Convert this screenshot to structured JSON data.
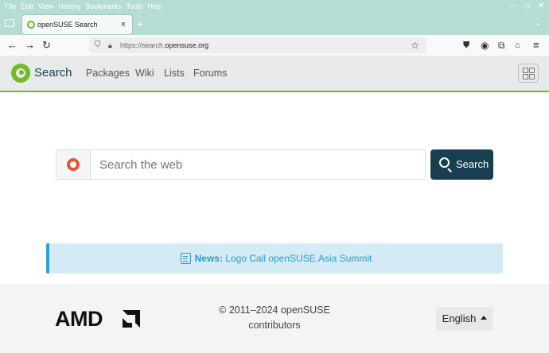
{
  "browser": {
    "menu": [
      "File",
      "Edit",
      "View",
      "History",
      "Bookmarks",
      "Tools",
      "Help"
    ],
    "tab_title": "openSUSE Search",
    "tab_close": "×",
    "new_tab": "+",
    "url_prefix": "https://search.",
    "url_domain": "opensuse.org",
    "icons": [
      "back-arrow-icon",
      "forward-arrow-icon",
      "reload-icon",
      "shield-icon",
      "lock-icon",
      "star-icon",
      "pocket-icon",
      "account-icon",
      "extensions-icon",
      "hat-icon",
      "hamburger-menu-icon"
    ]
  },
  "site": {
    "brand": "Search",
    "nav": [
      "Packages",
      "Wiki",
      "Lists",
      "Forums"
    ],
    "search_placeholder": "Search the web",
    "search_button": "Search",
    "news_label": "News:",
    "news_link": "Logo Call openSUSE.Asia Summit",
    "footer_sponsor": "AMD",
    "copyright_line1": "© 2011–2024 openSUSE",
    "copyright_line2": "contributors",
    "language": "English"
  },
  "colors": {
    "accent_green": "#73ba25",
    "dark_teal": "#173f4f",
    "news_blue": "#2a9bc9",
    "titlebar": "#b6dcd6"
  }
}
